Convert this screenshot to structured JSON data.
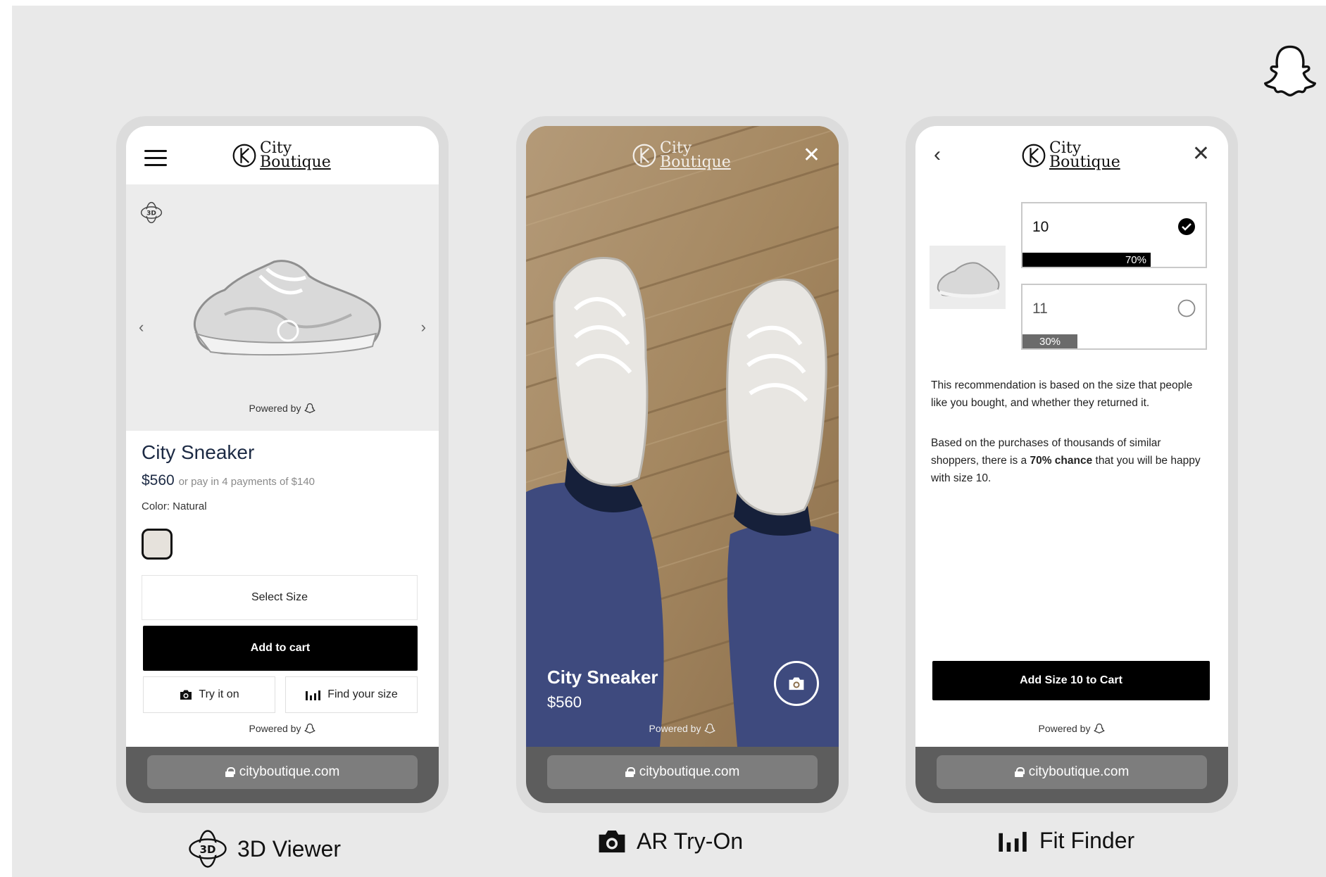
{
  "brand": {
    "line1": "City",
    "line2": "Boutique"
  },
  "url": "cityboutique.com",
  "powered_by": "Powered by",
  "viewer": {
    "product_name": "City Sneaker",
    "price": "$560",
    "installments": "or pay in 4 payments of $140",
    "color_label": "Color: Natural",
    "select_size": "Select Size",
    "add_to_cart": "Add to cart",
    "try_on": "Try it on",
    "find_size": "Find your size",
    "badge_3d": "3D"
  },
  "tryon": {
    "product_name": "City Sneaker",
    "price": "$560"
  },
  "fit": {
    "sizes": [
      {
        "size": "10",
        "percent": "70%",
        "fill": 0.7,
        "selected": true
      },
      {
        "size": "11",
        "percent": "30%",
        "fill": 0.3,
        "selected": false
      }
    ],
    "para1": "This recommendation is based on the size that people like you bought, and whether they returned it.",
    "para2_pre": "Based on the purchases of thousands of similar shoppers, there is a ",
    "para2_bold": "70% chance",
    "para2_post": " that you will be happy with size 10.",
    "cta": "Add Size 10 to Cart"
  },
  "captions": {
    "viewer": "3D Viewer",
    "tryon": "AR Try-On",
    "fit": "Fit Finder",
    "badge_3d": "3D"
  },
  "colors": {
    "cta": "#000000",
    "bar_selected": "#000000",
    "bar_other": "#6b6b6b",
    "url_bar": "#5d5d5d",
    "title_navy": "#1c2a44"
  }
}
